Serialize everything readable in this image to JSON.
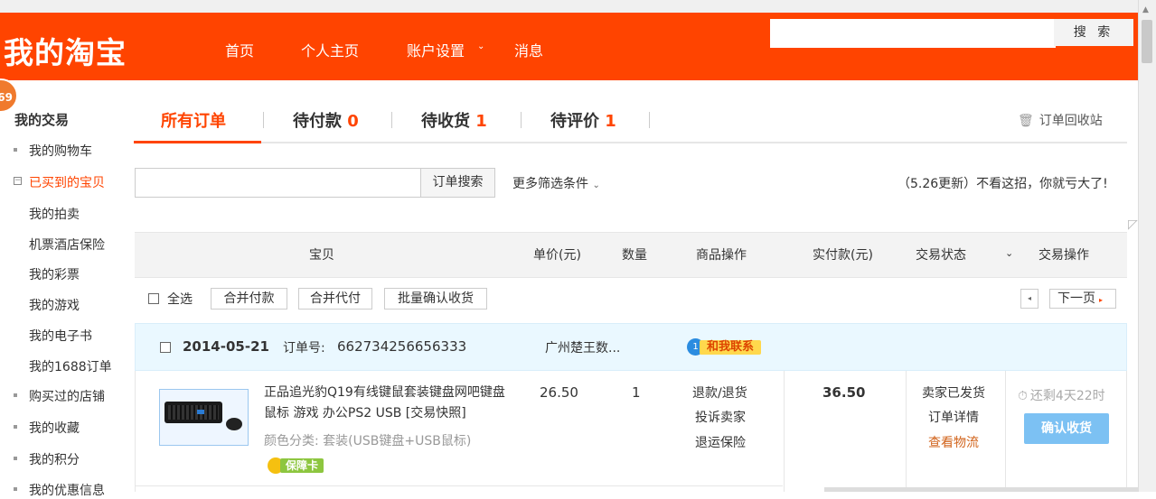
{
  "header": {
    "logo": "我的淘宝",
    "nav": [
      "首页",
      "个人主页",
      "账户设置",
      "消息"
    ],
    "nav_dropdown_icon": "chevron-down-icon",
    "search_placeholder": "",
    "search_button": "搜 索"
  },
  "badge": "69",
  "sidebar": {
    "title": "我的交易",
    "items": [
      {
        "label": "我的购物车"
      },
      {
        "label": "已买到的宝贝"
      },
      {
        "label": "我的拍卖"
      },
      {
        "label": "机票酒店保险"
      },
      {
        "label": "我的彩票"
      },
      {
        "label": "我的游戏"
      },
      {
        "label": "我的电子书"
      },
      {
        "label": "我的1688订单"
      },
      {
        "label": "购买过的店铺"
      },
      {
        "label": "我的收藏"
      },
      {
        "label": "我的积分"
      },
      {
        "label": "我的优惠信息"
      }
    ]
  },
  "tabs": [
    {
      "label": "所有订单",
      "count": ""
    },
    {
      "label": "待付款",
      "count": "0"
    },
    {
      "label": "待收货",
      "count": "1"
    },
    {
      "label": "待评价",
      "count": "1"
    }
  ],
  "recycle_bin": "订单回收站",
  "order_search": {
    "placeholder": "",
    "button": "订单搜索"
  },
  "more_filters": "更多筛选条件",
  "promo": "（5.26更新）不看这招，你就亏大了!",
  "table_headers": [
    "宝贝",
    "单价(元)",
    "数量",
    "商品操作",
    "实付款(元)",
    "交易状态",
    "交易操作"
  ],
  "bulk": {
    "select_all": "全选",
    "merge_pay": "合并付款",
    "merge_proxy": "合并代付",
    "batch_confirm": "批量确认收货",
    "prev_icon": "◂",
    "next_page": "下一页"
  },
  "order": {
    "date": "2014-05-21",
    "order_no_label": "订单号:",
    "order_no": "662734256656333",
    "seller": "广州楚王数...",
    "contact": "和我联系",
    "item": {
      "title": "正品追光豹Q19有线键鼠套装键盘网吧键盘鼠标 游戏 办公PS2 USB [交易快照]",
      "variant": "颜色分类: 套装(USB键盘+USB鼠标)",
      "guarantee": "保障卡",
      "price": "26.50",
      "qty": "1",
      "item_ops": [
        "退款/退货",
        "投诉卖家",
        "退运保险"
      ]
    },
    "paid": "36.50",
    "status": [
      "卖家已发货",
      "订单详情",
      "查看物流"
    ],
    "remaining": "还剩4天22时",
    "confirm_button": "确认收货"
  }
}
